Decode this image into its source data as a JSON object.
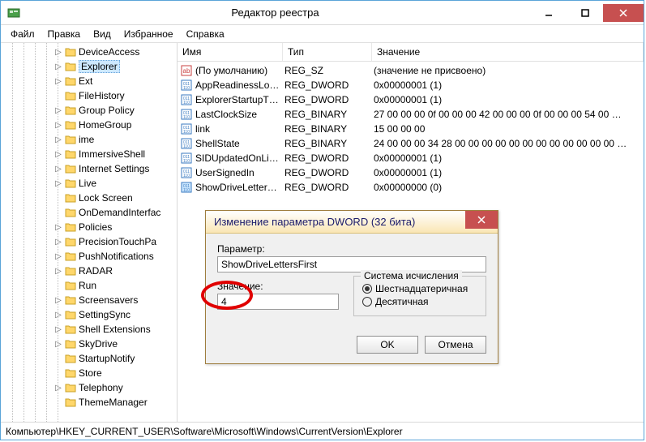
{
  "window": {
    "title": "Редактор реестра"
  },
  "menu": {
    "file": "Файл",
    "edit": "Правка",
    "view": "Вид",
    "favorites": "Избранное",
    "help": "Справка"
  },
  "tree": {
    "items": [
      {
        "label": "DeviceAccess",
        "expandable": true
      },
      {
        "label": "Explorer",
        "expandable": true,
        "selected": true
      },
      {
        "label": "Ext",
        "expandable": true
      },
      {
        "label": "FileHistory",
        "expandable": false
      },
      {
        "label": "Group Policy",
        "expandable": true
      },
      {
        "label": "HomeGroup",
        "expandable": true
      },
      {
        "label": "ime",
        "expandable": true
      },
      {
        "label": "ImmersiveShell",
        "expandable": true
      },
      {
        "label": "Internet Settings",
        "expandable": true
      },
      {
        "label": "Live",
        "expandable": true
      },
      {
        "label": "Lock Screen",
        "expandable": false
      },
      {
        "label": "OnDemandInterfac",
        "expandable": false
      },
      {
        "label": "Policies",
        "expandable": true
      },
      {
        "label": "PrecisionTouchPa",
        "expandable": true
      },
      {
        "label": "PushNotifications",
        "expandable": true
      },
      {
        "label": "RADAR",
        "expandable": true
      },
      {
        "label": "Run",
        "expandable": false
      },
      {
        "label": "Screensavers",
        "expandable": true
      },
      {
        "label": "SettingSync",
        "expandable": true
      },
      {
        "label": "Shell Extensions",
        "expandable": true
      },
      {
        "label": "SkyDrive",
        "expandable": true
      },
      {
        "label": "StartupNotify",
        "expandable": false
      },
      {
        "label": "Store",
        "expandable": false
      },
      {
        "label": "Telephony",
        "expandable": true
      },
      {
        "label": "ThemeManager",
        "expandable": false
      }
    ]
  },
  "list": {
    "columns": {
      "name": "Имя",
      "type": "Тип",
      "value": "Значение"
    },
    "rows": [
      {
        "icon": "string",
        "name": "(По умолчанию)",
        "type": "REG_SZ",
        "value": "(значение не присвоено)"
      },
      {
        "icon": "binary",
        "name": "AppReadinessLo…",
        "type": "REG_DWORD",
        "value": "0x00000001 (1)"
      },
      {
        "icon": "binary",
        "name": "ExplorerStartupT…",
        "type": "REG_DWORD",
        "value": "0x00000001 (1)"
      },
      {
        "icon": "binary",
        "name": "LastClockSize",
        "type": "REG_BINARY",
        "value": "27 00 00 00 0f 00 00 00 42 00 00 00 0f 00 00 00 54 00 …"
      },
      {
        "icon": "binary",
        "name": "link",
        "type": "REG_BINARY",
        "value": "15 00 00 00"
      },
      {
        "icon": "binary",
        "name": "ShellState",
        "type": "REG_BINARY",
        "value": "24 00 00 00 34 28 00 00 00 00 00 00 00 00 00 00 00 00 …"
      },
      {
        "icon": "binary",
        "name": "SIDUpdatedOnLi…",
        "type": "REG_DWORD",
        "value": "0x00000001 (1)"
      },
      {
        "icon": "binary",
        "name": "UserSignedIn",
        "type": "REG_DWORD",
        "value": "0x00000001 (1)"
      },
      {
        "icon": "binary-sel",
        "name": "ShowDriveLetter…",
        "type": "REG_DWORD",
        "value": "0x00000000 (0)"
      }
    ]
  },
  "dialog": {
    "title": "Изменение параметра DWORD (32 бита)",
    "param_label": "Параметр:",
    "param_value": "ShowDriveLettersFirst",
    "value_label": "Значение:",
    "value_value": "4",
    "radix_legend": "Система исчисления",
    "radix_hex": "Шестнадцатеричная",
    "radix_dec": "Десятичная",
    "ok": "OK",
    "cancel": "Отмена"
  },
  "statusbar": {
    "path": "Компьютер\\HKEY_CURRENT_USER\\Software\\Microsoft\\Windows\\CurrentVersion\\Explorer"
  }
}
